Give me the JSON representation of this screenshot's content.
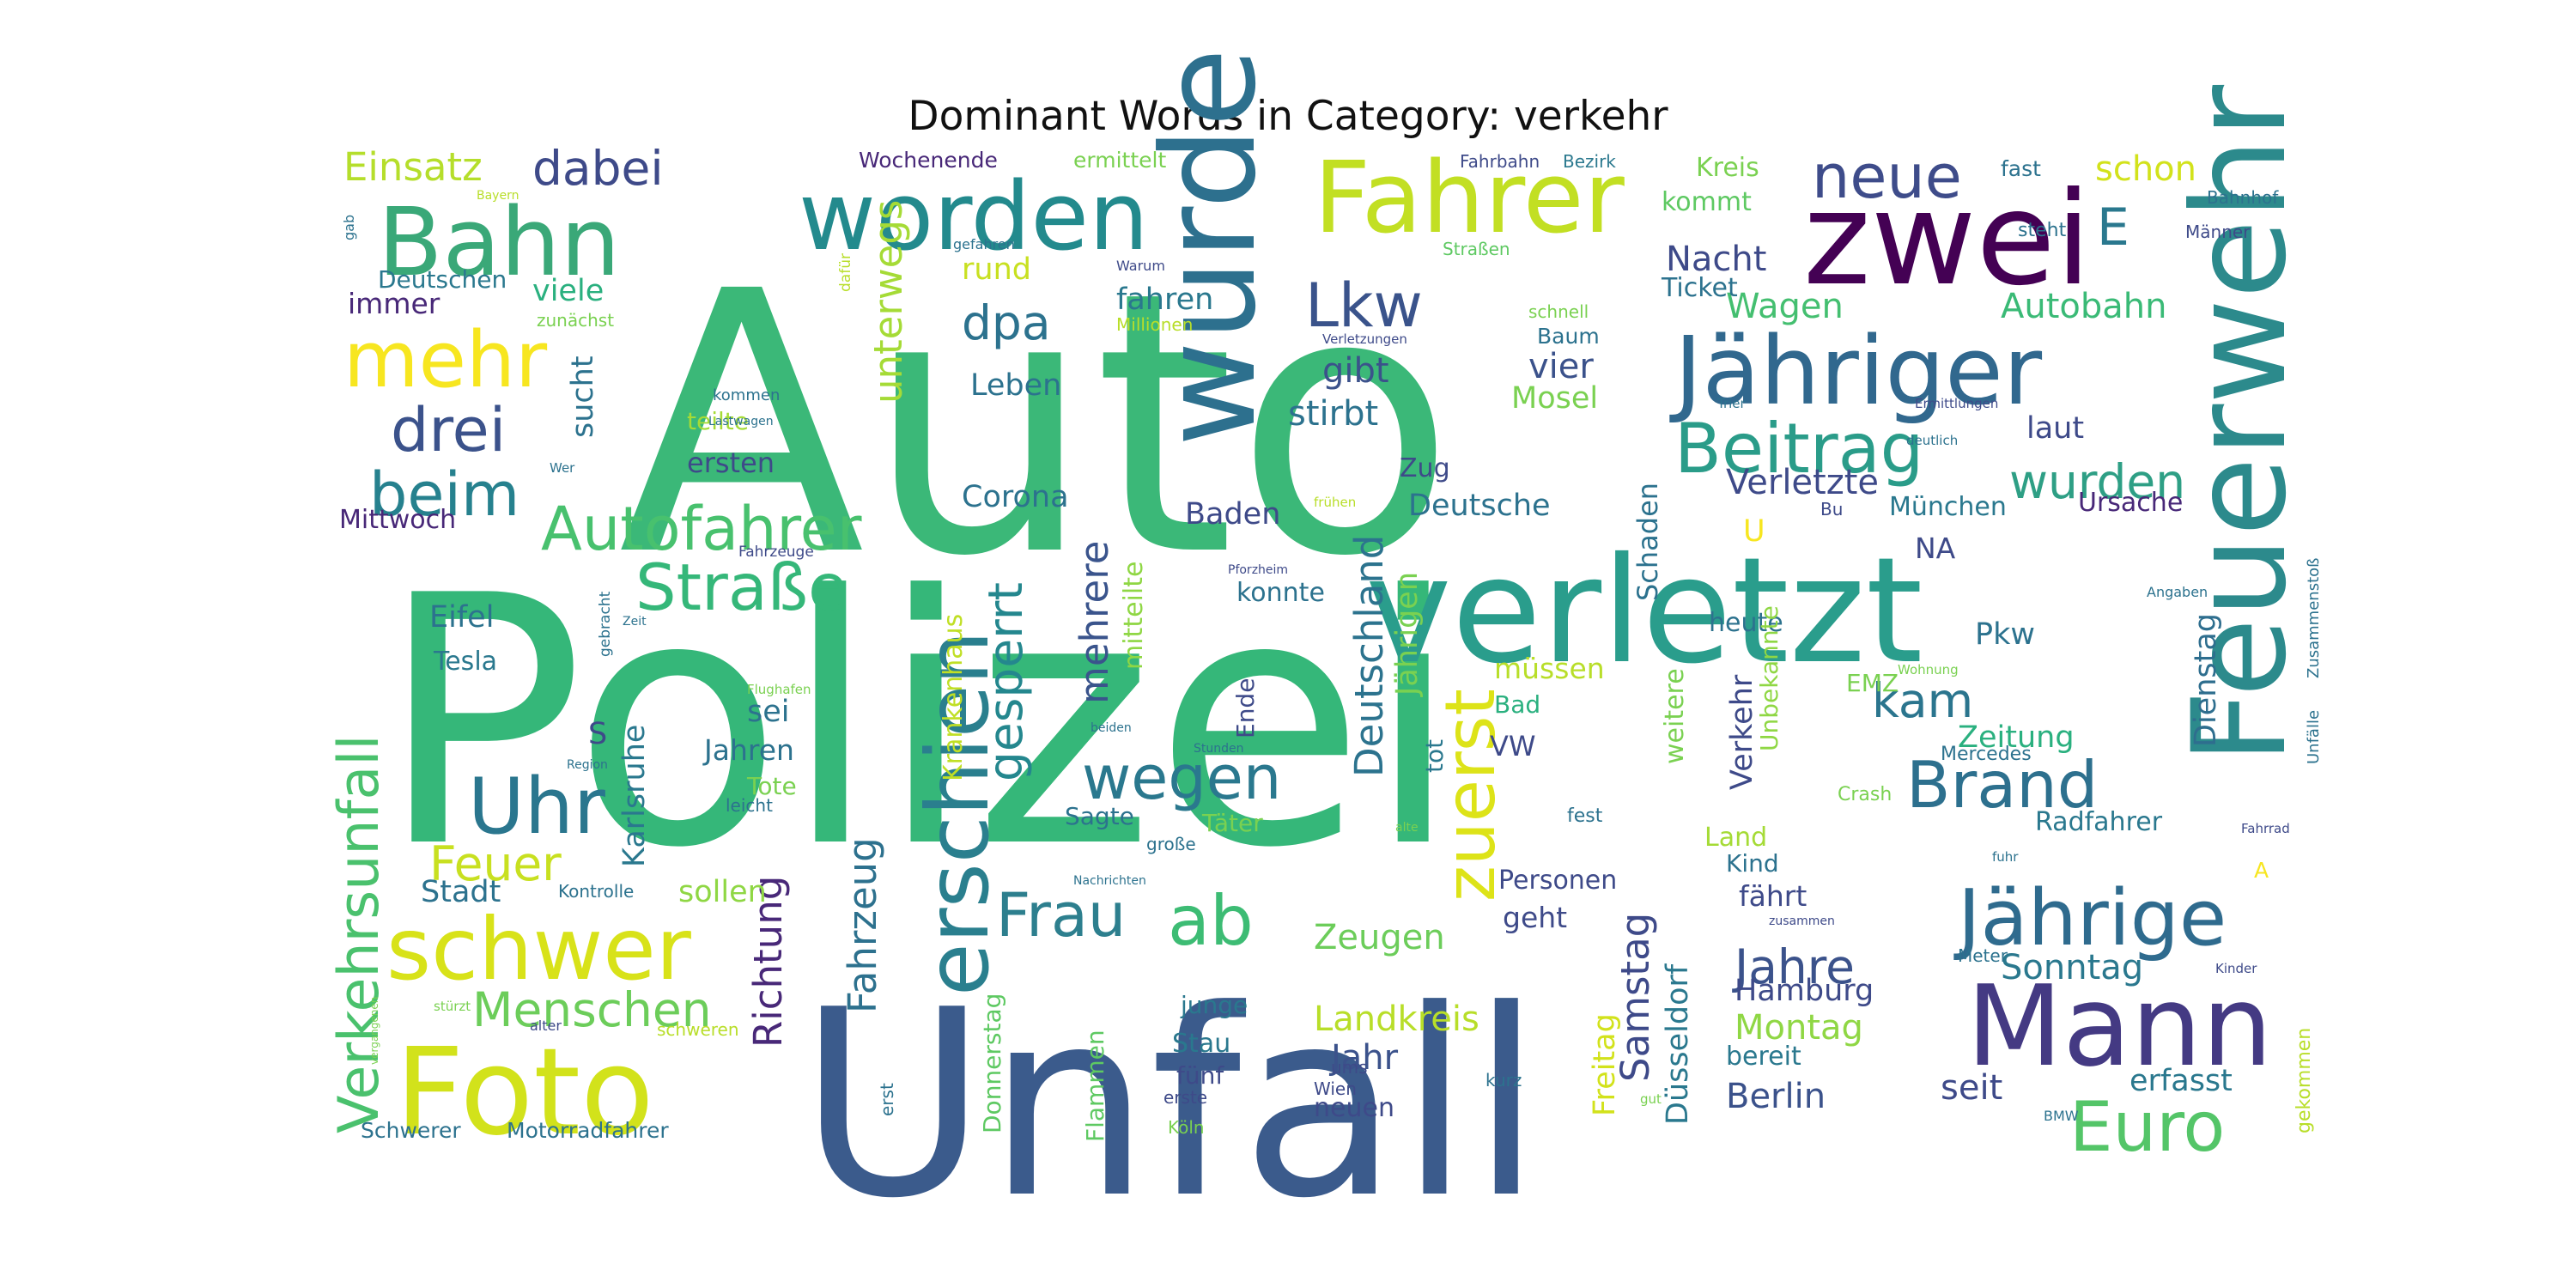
{
  "chart_data": {
    "type": "wordcloud",
    "title": "Dominant Words in Category: verkehr",
    "colormap": "viridis",
    "words": [
      {
        "text": "Polizei",
        "weight": 1.0,
        "color": "#35b779"
      },
      {
        "text": "Auto",
        "weight": 0.96,
        "color": "#3bb878"
      },
      {
        "text": "Unfall",
        "weight": 0.95,
        "color": "#3b5b8c"
      },
      {
        "text": "verletzt",
        "weight": 0.4,
        "color": "#2a9d8c"
      },
      {
        "text": "wurde",
        "weight": 0.33,
        "color": "#2d708e"
      },
      {
        "text": "Feuerwehr",
        "weight": 0.32,
        "color": "#2c8a8c"
      },
      {
        "text": "zwei",
        "weight": 0.3,
        "color": "#440154"
      },
      {
        "text": "Mann",
        "weight": 0.3,
        "color": "#443a83"
      },
      {
        "text": "Foto",
        "weight": 0.26,
        "color": "#d2e21b"
      },
      {
        "text": "worden",
        "weight": 0.21,
        "color": "#238a8d"
      },
      {
        "text": "Fahrer",
        "weight": 0.21,
        "color": "#c2df23"
      },
      {
        "text": "Jähriger",
        "weight": 0.21,
        "color": "#31688e"
      },
      {
        "text": "erschien",
        "weight": 0.2,
        "color": "#2a7f8e"
      },
      {
        "text": "schwer",
        "weight": 0.2,
        "color": "#d8e219"
      },
      {
        "text": "Bahn",
        "weight": 0.2,
        "color": "#3aa878"
      },
      {
        "text": "Jährige",
        "weight": 0.19,
        "color": "#2f6b8e"
      },
      {
        "text": "Beitrag",
        "weight": 0.17,
        "color": "#2a9c89"
      },
      {
        "text": "mehr",
        "weight": 0.16,
        "color": "#f7e620"
      },
      {
        "text": "Verkehrsunfall",
        "weight": 0.15,
        "color": "#4ac16d"
      },
      {
        "text": "Euro",
        "weight": 0.15,
        "color": "#54c568"
      },
      {
        "text": "Uhr",
        "weight": 0.15,
        "color": "#2a768e"
      },
      {
        "text": "ab",
        "weight": 0.15,
        "color": "#3dbc74"
      },
      {
        "text": "Frau",
        "weight": 0.14,
        "color": "#2d7f8e"
      },
      {
        "text": "zuerst",
        "weight": 0.14,
        "color": "#dde318"
      },
      {
        "text": "Brand",
        "weight": 0.14,
        "color": "#2d708e"
      },
      {
        "text": "Straße",
        "weight": 0.14,
        "color": "#35b779"
      },
      {
        "text": "Autofahrer",
        "weight": 0.13,
        "color": "#48c16e"
      },
      {
        "text": "neue",
        "weight": 0.13,
        "color": "#3e4c8a"
      },
      {
        "text": "beim",
        "weight": 0.13,
        "color": "#26818e"
      },
      {
        "text": "drei",
        "weight": 0.13,
        "color": "#3b528b"
      },
      {
        "text": "wegen",
        "weight": 0.13,
        "color": "#2a788e"
      },
      {
        "text": "Menschen",
        "weight": 0.12,
        "color": "#6ccd5a"
      },
      {
        "text": "Lkw",
        "weight": 0.12,
        "color": "#3a538b"
      },
      {
        "text": "wurden",
        "weight": 0.11,
        "color": "#2e9f85"
      },
      {
        "text": "dpa",
        "weight": 0.11,
        "color": "#2c728e"
      },
      {
        "text": "Feuer",
        "weight": 0.11,
        "color": "#c8e020"
      },
      {
        "text": "gesperrt",
        "weight": 0.1,
        "color": "#24878e"
      },
      {
        "text": "kam",
        "weight": 0.1,
        "color": "#2b758e"
      },
      {
        "text": "Jahre",
        "weight": 0.1,
        "color": "#3b528b"
      },
      {
        "text": "dabei",
        "weight": 0.1,
        "color": "#3e4a89"
      },
      {
        "text": "Einsatz",
        "weight": 0.09,
        "color": "#b5de2b"
      },
      {
        "text": "mehrere",
        "weight": 0.09,
        "color": "#3a548c"
      },
      {
        "text": "unterwegs",
        "weight": 0.09,
        "color": "#a5db36"
      },
      {
        "text": "Deutschland",
        "weight": 0.09,
        "color": "#2c738e"
      },
      {
        "text": "Fahrzeug",
        "weight": 0.09,
        "color": "#2d718e"
      },
      {
        "text": "Samstag",
        "weight": 0.09,
        "color": "#3e4a89"
      },
      {
        "text": "Sonntag",
        "weight": 0.09,
        "color": "#2a788e"
      },
      {
        "text": "Richtung",
        "weight": 0.08,
        "color": "#482878"
      },
      {
        "text": "Zeugen",
        "weight": 0.08,
        "color": "#6ccd5a"
      },
      {
        "text": "Landkreis",
        "weight": 0.08,
        "color": "#b8de29"
      },
      {
        "text": "Autobahn",
        "weight": 0.08,
        "color": "#3aba76"
      },
      {
        "text": "Wagen",
        "weight": 0.08,
        "color": "#44bf70"
      },
      {
        "text": "Verletzte",
        "weight": 0.08,
        "color": "#3e4a89"
      },
      {
        "text": "stirbt",
        "weight": 0.08,
        "color": "#2c728e"
      },
      {
        "text": "Montag",
        "weight": 0.08,
        "color": "#8fd744"
      },
      {
        "text": "Berlin",
        "weight": 0.08,
        "color": "#3b528b"
      },
      {
        "text": "Nacht",
        "weight": 0.08,
        "color": "#3e4a89"
      },
      {
        "text": "gibt",
        "weight": 0.07,
        "color": "#3b528b"
      },
      {
        "text": "seit",
        "weight": 0.07,
        "color": "#3e4a89"
      },
      {
        "text": "erfasst",
        "weight": 0.07,
        "color": "#2a788e"
      },
      {
        "text": "Jahr",
        "weight": 0.07,
        "color": "#3b528b"
      },
      {
        "text": "Zeitung",
        "weight": 0.07,
        "color": "#2ab07f"
      },
      {
        "text": "Dienstag",
        "weight": 0.07,
        "color": "#2e6e8e"
      },
      {
        "text": "Hamburg",
        "weight": 0.07,
        "color": "#3e4a89"
      },
      {
        "text": "Karlsruhe",
        "weight": 0.07,
        "color": "#2a788e"
      },
      {
        "text": "Jährigen",
        "weight": 0.07,
        "color": "#7ad151"
      },
      {
        "text": "Krankenhaus",
        "weight": 0.07,
        "color": "#c0df25"
      },
      {
        "text": "Freitag",
        "weight": 0.07,
        "color": "#d2e21b"
      },
      {
        "text": "Düsseldorf",
        "weight": 0.07,
        "color": "#2a788e"
      },
      {
        "text": "Pkw",
        "weight": 0.07,
        "color": "#2c728e"
      },
      {
        "text": "Verkehr",
        "weight": 0.07,
        "color": "#3e4a89"
      },
      {
        "text": "vier",
        "weight": 0.07,
        "color": "#3b528b"
      },
      {
        "text": "laut",
        "weight": 0.07,
        "color": "#3e4a89"
      },
      {
        "text": "rund",
        "weight": 0.07,
        "color": "#c8e020"
      },
      {
        "text": "Mosel",
        "weight": 0.07,
        "color": "#7ad151"
      },
      {
        "text": "Baden",
        "weight": 0.07,
        "color": "#3e4a89"
      },
      {
        "text": "Deutsche",
        "weight": 0.07,
        "color": "#2c728e"
      },
      {
        "text": "Corona",
        "weight": 0.07,
        "color": "#2c728e"
      },
      {
        "text": "viele",
        "weight": 0.07,
        "color": "#2ab07f"
      },
      {
        "text": "sucht",
        "weight": 0.07,
        "color": "#2c728e"
      },
      {
        "text": "Leben",
        "weight": 0.07,
        "color": "#2c728e"
      },
      {
        "text": "fahren",
        "weight": 0.07,
        "color": "#2a788e"
      },
      {
        "text": "schon",
        "weight": 0.07,
        "color": "#d2e21b"
      },
      {
        "text": "Stadt",
        "weight": 0.07,
        "color": "#2c728e"
      },
      {
        "text": "sollen",
        "weight": 0.07,
        "color": "#8fd744"
      },
      {
        "text": "sei",
        "weight": 0.07,
        "color": "#2c728e"
      },
      {
        "text": "Jahren",
        "weight": 0.07,
        "color": "#2c728e"
      },
      {
        "text": "Eifel",
        "weight": 0.07,
        "color": "#2c728e"
      },
      {
        "text": "Tesla",
        "weight": 0.06,
        "color": "#2a788e"
      },
      {
        "text": "Mittwoch",
        "weight": 0.06,
        "color": "#482878"
      },
      {
        "text": "immer",
        "weight": 0.06,
        "color": "#482878"
      },
      {
        "text": "Deutschen",
        "weight": 0.06,
        "color": "#2a788e"
      },
      {
        "text": "ersten",
        "weight": 0.06,
        "color": "#3e4a89"
      },
      {
        "text": "teilte",
        "weight": 0.06,
        "color": "#a5db36"
      },
      {
        "text": "mitteilte",
        "weight": 0.06,
        "color": "#8fd744"
      },
      {
        "text": "konnte",
        "weight": 0.06,
        "color": "#2c728e"
      },
      {
        "text": "Ende",
        "weight": 0.06,
        "color": "#3e4a89"
      },
      {
        "text": "müssen",
        "weight": 0.06,
        "color": "#b8de29"
      },
      {
        "text": "Bad",
        "weight": 0.06,
        "color": "#2ab07f"
      },
      {
        "text": "tot",
        "weight": 0.06,
        "color": "#2a788e"
      },
      {
        "text": "VW",
        "weight": 0.06,
        "color": "#3e4a89"
      },
      {
        "text": "Schaden",
        "weight": 0.06,
        "color": "#2c728e"
      },
      {
        "text": "heute",
        "weight": 0.06,
        "color": "#2c728e"
      },
      {
        "text": "weitere",
        "weight": 0.06,
        "color": "#7ad151"
      },
      {
        "text": "Unbekannte",
        "weight": 0.06,
        "color": "#8fd744"
      },
      {
        "text": "Land",
        "weight": 0.06,
        "color": "#a5db36"
      },
      {
        "text": "Kind",
        "weight": 0.06,
        "color": "#2c728e"
      },
      {
        "text": "fährt",
        "weight": 0.06,
        "color": "#3e4a89"
      },
      {
        "text": "bereit",
        "weight": 0.06,
        "color": "#2a788e"
      },
      {
        "text": "Zug",
        "weight": 0.06,
        "color": "#3e4a89"
      },
      {
        "text": "NA",
        "weight": 0.06,
        "color": "#3e4a89"
      },
      {
        "text": "München",
        "weight": 0.06,
        "color": "#2a788e"
      },
      {
        "text": "Ursache",
        "weight": 0.06,
        "color": "#482878"
      },
      {
        "text": "Radfahrer",
        "weight": 0.06,
        "color": "#2a788e"
      },
      {
        "text": "Personen",
        "weight": 0.06,
        "color": "#3e4a89"
      },
      {
        "text": "geht",
        "weight": 0.06,
        "color": "#3e4a89"
      },
      {
        "text": "Sagte",
        "weight": 0.06,
        "color": "#2c728e"
      },
      {
        "text": "Täter",
        "weight": 0.06,
        "color": "#7ad151"
      },
      {
        "text": "Tote",
        "weight": 0.06,
        "color": "#7ad151"
      },
      {
        "text": "Donnerstag",
        "weight": 0.06,
        "color": "#5ec962"
      },
      {
        "text": "Flammen",
        "weight": 0.06,
        "color": "#5ec962"
      },
      {
        "text": "junge",
        "weight": 0.06,
        "color": "#2a788e"
      },
      {
        "text": "Stau",
        "weight": 0.06,
        "color": "#2a788e"
      },
      {
        "text": "fünf",
        "weight": 0.06,
        "color": "#3e4a89"
      },
      {
        "text": "neuen",
        "weight": 0.06,
        "color": "#3e4a89"
      },
      {
        "text": "Kreis",
        "weight": 0.06,
        "color": "#7ad151"
      },
      {
        "text": "kommt",
        "weight": 0.06,
        "color": "#5ec962"
      },
      {
        "text": "Ticket",
        "weight": 0.06,
        "color": "#2c728e"
      },
      {
        "text": "Baum",
        "weight": 0.05,
        "color": "#2c728e"
      },
      {
        "text": "Schwerer",
        "weight": 0.05,
        "color": "#2c728e"
      },
      {
        "text": "Motorradfahrer",
        "weight": 0.05,
        "color": "#2c728e"
      },
      {
        "text": "Wochenende",
        "weight": 0.05,
        "color": "#482878"
      },
      {
        "text": "ermittelt",
        "weight": 0.05,
        "color": "#7ad151"
      },
      {
        "text": "Fahrbahn",
        "weight": 0.05,
        "color": "#3e4a89"
      },
      {
        "text": "Bezirk",
        "weight": 0.05,
        "color": "#2a788e"
      },
      {
        "text": "fast",
        "weight": 0.05,
        "color": "#2c728e"
      },
      {
        "text": "steht",
        "weight": 0.05,
        "color": "#2c728e"
      },
      {
        "text": "Kontrolle",
        "weight": 0.05,
        "color": "#2c728e"
      },
      {
        "text": "EMZ",
        "weight": 0.05,
        "color": "#7ad151"
      },
      {
        "text": "Mercedes",
        "weight": 0.04,
        "color": "#2c728e"
      },
      {
        "text": "Crash",
        "weight": 0.04,
        "color": "#7ad151"
      },
      {
        "text": "fest",
        "weight": 0.04,
        "color": "#2c728e"
      },
      {
        "text": "große",
        "weight": 0.04,
        "color": "#2c728e"
      },
      {
        "text": "erste",
        "weight": 0.04,
        "color": "#3e4a89"
      },
      {
        "text": "Köln",
        "weight": 0.04,
        "color": "#7ad151"
      },
      {
        "text": "Wien",
        "weight": 0.04,
        "color": "#3e4a89"
      },
      {
        "text": "kurz",
        "weight": 0.04,
        "color": "#2c728e"
      },
      {
        "text": "erst",
        "weight": 0.04,
        "color": "#2c728e"
      },
      {
        "text": "gekommen",
        "weight": 0.04,
        "color": "#b8de29"
      },
      {
        "text": "Meter",
        "weight": 0.04,
        "color": "#2c728e"
      },
      {
        "text": "Unfälle",
        "weight": 0.04,
        "color": "#2c728e"
      },
      {
        "text": "Zusammenstoß",
        "weight": 0.04,
        "color": "#2c728e"
      },
      {
        "text": "leicht",
        "weight": 0.04,
        "color": "#2c728e"
      },
      {
        "text": "gebracht",
        "weight": 0.04,
        "color": "#2c728e"
      },
      {
        "text": "zunächst",
        "weight": 0.04,
        "color": "#7ad151"
      },
      {
        "text": "Millionen",
        "weight": 0.04,
        "color": "#b8de29"
      },
      {
        "text": "schnell",
        "weight": 0.04,
        "color": "#7ad151"
      },
      {
        "text": "Straßen",
        "weight": 0.04,
        "color": "#5ec962"
      },
      {
        "text": "Männer",
        "weight": 0.04,
        "color": "#3e4a89"
      },
      {
        "text": "Bahnhof",
        "weight": 0.04,
        "color": "#2c728e"
      },
      {
        "text": "Warum",
        "weight": 0.03,
        "color": "#3e4a89"
      },
      {
        "text": "gefahren",
        "weight": 0.03,
        "color": "#2c728e"
      },
      {
        "text": "dafür",
        "weight": 0.03,
        "color": "#b8de29"
      },
      {
        "text": "kommen",
        "weight": 0.03,
        "color": "#2c728e"
      },
      {
        "text": "Lastwagen",
        "weight": 0.03,
        "color": "#2c728e"
      },
      {
        "text": "Verletzungen",
        "weight": 0.03,
        "color": "#3e4a89"
      },
      {
        "text": "Trier",
        "weight": 0.03,
        "color": "#2c728e"
      },
      {
        "text": "Ermittlungen",
        "weight": 0.03,
        "color": "#3e4a89"
      },
      {
        "text": "deutlich",
        "weight": 0.03,
        "color": "#2c728e"
      },
      {
        "text": "Bu",
        "weight": 0.03,
        "color": "#3e4a89"
      },
      {
        "text": "Angaben",
        "weight": 0.03,
        "color": "#2c728e"
      },
      {
        "text": "Wohnung",
        "weight": 0.03,
        "color": "#7ad151"
      },
      {
        "text": "Fahrrad",
        "weight": 0.03,
        "color": "#3e4a89"
      },
      {
        "text": "fuhr",
        "weight": 0.03,
        "color": "#2c728e"
      },
      {
        "text": "Kinder",
        "weight": 0.03,
        "color": "#3e4a89"
      },
      {
        "text": "BMW",
        "weight": 0.03,
        "color": "#2c728e"
      },
      {
        "text": "gut",
        "weight": 0.03,
        "color": "#7ad151"
      },
      {
        "text": "zusammen",
        "weight": 0.03,
        "color": "#3e4a89"
      },
      {
        "text": "ums",
        "weight": 0.03,
        "color": "#3e4a89"
      },
      {
        "text": "Nachrichten",
        "weight": 0.03,
        "color": "#2c728e"
      },
      {
        "text": "alte",
        "weight": 0.03,
        "color": "#7ad151"
      },
      {
        "text": "Stunden",
        "weight": 0.03,
        "color": "#2c728e"
      },
      {
        "text": "beiden",
        "weight": 0.03,
        "color": "#2c728e"
      },
      {
        "text": "Flughafen",
        "weight": 0.03,
        "color": "#7ad151"
      },
      {
        "text": "Pforzheim",
        "weight": 0.03,
        "color": "#3e4a89"
      },
      {
        "text": "frühen",
        "weight": 0.03,
        "color": "#b8de29"
      },
      {
        "text": "Region",
        "weight": 0.03,
        "color": "#2c728e"
      },
      {
        "text": "Zeit",
        "weight": 0.03,
        "color": "#2c728e"
      },
      {
        "text": "Fahrzeuge",
        "weight": 0.03,
        "color": "#3e4a89"
      },
      {
        "text": "Wer",
        "weight": 0.03,
        "color": "#2c728e"
      },
      {
        "text": "gab",
        "weight": 0.03,
        "color": "#2c728e"
      },
      {
        "text": "Bayern",
        "weight": 0.03,
        "color": "#b8de29"
      },
      {
        "text": "stürzt",
        "weight": 0.03,
        "color": "#7ad151"
      },
      {
        "text": "alter",
        "weight": 0.03,
        "color": "#3e4a89"
      },
      {
        "text": "schweren",
        "weight": 0.03,
        "color": "#b8de29"
      },
      {
        "text": "vergangenen",
        "weight": 0.03,
        "color": "#7ad151"
      },
      {
        "text": "S",
        "weight": 0.05,
        "color": "#3e4a89"
      },
      {
        "text": "E",
        "weight": 0.08,
        "color": "#2a788e"
      },
      {
        "text": "U",
        "weight": 0.05,
        "color": "#f7e620"
      },
      {
        "text": "A",
        "weight": 0.03,
        "color": "#f7e620"
      }
    ]
  }
}
